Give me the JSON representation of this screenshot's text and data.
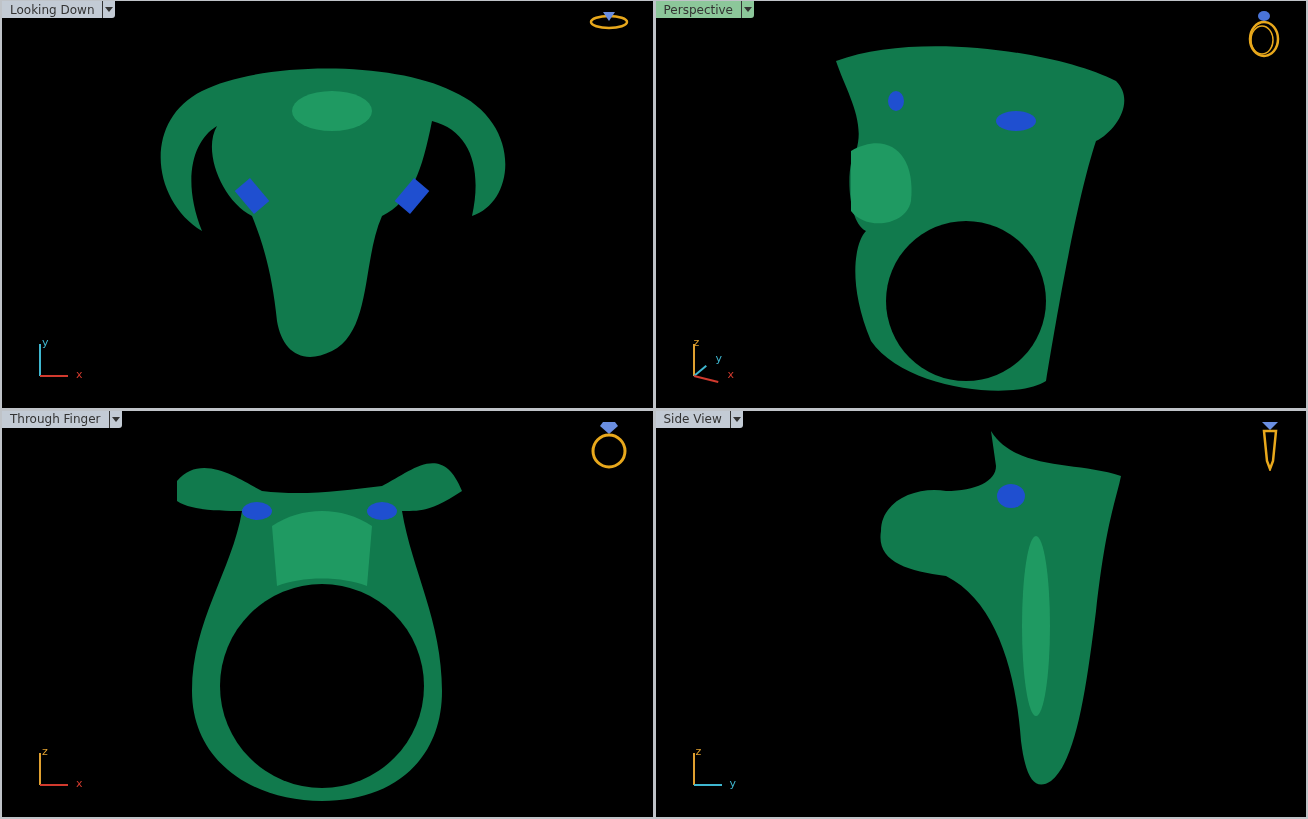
{
  "viewports": [
    {
      "title": "Looking Down",
      "selected": false,
      "kind": "top",
      "axes": [
        {
          "label": "y",
          "color": "#3fb7d0"
        },
        {
          "label": "x",
          "color": "#d23a2e"
        }
      ]
    },
    {
      "title": "Perspective",
      "selected": true,
      "kind": "perspective",
      "axes": [
        {
          "label": "z",
          "color": "#e0a030"
        },
        {
          "label": "y",
          "color": "#3fb7d0"
        },
        {
          "label": "x",
          "color": "#d23a2e"
        }
      ]
    },
    {
      "title": "Through Finger",
      "selected": false,
      "kind": "front",
      "axes": [
        {
          "label": "z",
          "color": "#e0a030"
        },
        {
          "label": "x",
          "color": "#d23a2e"
        }
      ]
    },
    {
      "title": "Side View",
      "selected": false,
      "kind": "side",
      "axes": [
        {
          "label": "z",
          "color": "#e0a030"
        },
        {
          "label": "y",
          "color": "#3fb7d0"
        }
      ]
    }
  ]
}
